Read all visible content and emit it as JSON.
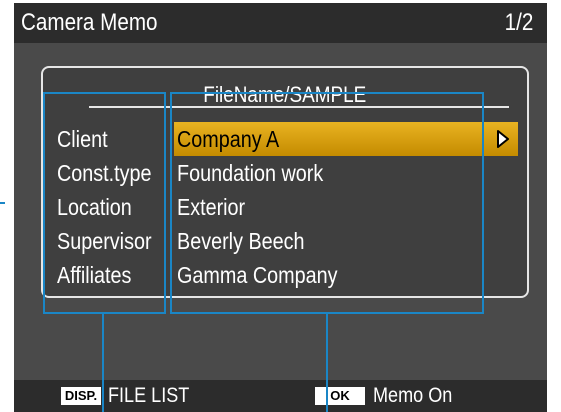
{
  "header": {
    "title": "Camera Memo",
    "page": "1/2"
  },
  "memo": {
    "filename": "FileName/SAMPLE",
    "rows": [
      {
        "label": "Client",
        "value": "Company A",
        "selected": true
      },
      {
        "label": "Const.type",
        "value": "Foundation work"
      },
      {
        "label": "Location",
        "value": "Exterior"
      },
      {
        "label": "Supervisor",
        "value": "Beverly Beech"
      },
      {
        "label": "Affiliates",
        "value": "Gamma Company"
      }
    ]
  },
  "footer": {
    "disp_key": "DISP.",
    "disp_label": "FILE LIST",
    "ok_key": "OK",
    "ok_label": "Memo On"
  },
  "colors": {
    "selection": "#d9a007",
    "callout": "#1a86c6",
    "screen_bg": "#4a4a4a",
    "bar_bg": "#2c2c2c"
  },
  "icons": {
    "selected_row_arrow": "triangle-right-icon"
  }
}
